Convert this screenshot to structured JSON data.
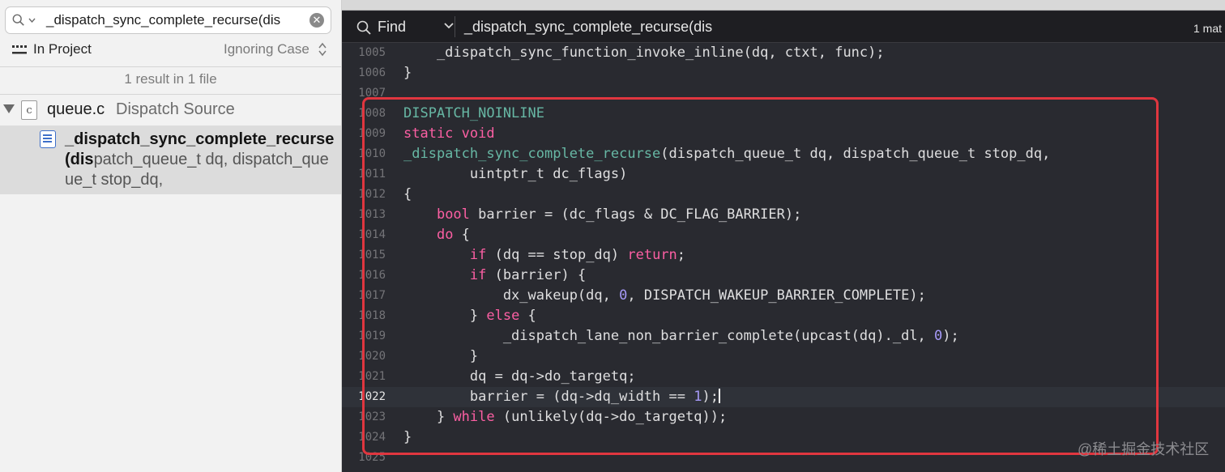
{
  "navigator": {
    "search_query": "_dispatch_sync_complete_recurse(dis",
    "scope_label": "In Project",
    "case_option": "Ignoring Case",
    "summary": "1 result in 1 file",
    "file": {
      "name": "queue.c",
      "kind": "Dispatch Source"
    },
    "result": {
      "match_bold": "_dispatch_sync_complete_recurse(dis",
      "match_rest": "patch_queue_t dq, dispatch_queue_t stop_dq,"
    }
  },
  "findbar": {
    "mode_label": "Find",
    "query": "_dispatch_sync_complete_recurse(dis",
    "match_count": "1 mat"
  },
  "code_lines": [
    {
      "n": "1005",
      "segments": [
        {
          "t": "    _dispatch_sync_function_invoke_inline(dq, ctxt, func);",
          "c": ""
        }
      ]
    },
    {
      "n": "1006",
      "segments": [
        {
          "t": "}",
          "c": ""
        }
      ]
    },
    {
      "n": "1007",
      "segments": []
    },
    {
      "n": "1008",
      "segments": [
        {
          "t": "DISPATCH_NOINLINE",
          "c": "fn"
        }
      ]
    },
    {
      "n": "1009",
      "segments": [
        {
          "t": "static void",
          "c": "kw"
        }
      ]
    },
    {
      "n": "1010",
      "segments": [
        {
          "t": "_dispatch_sync_complete_recurse",
          "c": "fn"
        },
        {
          "t": "(dispatch_queue_t dq, dispatch_queue_t stop_dq,",
          "c": ""
        }
      ]
    },
    {
      "n": "1011",
      "segments": [
        {
          "t": "        uintptr_t dc_flags)",
          "c": ""
        }
      ]
    },
    {
      "n": "1012",
      "segments": [
        {
          "t": "{",
          "c": ""
        }
      ]
    },
    {
      "n": "1013",
      "segments": [
        {
          "t": "    ",
          "c": ""
        },
        {
          "t": "bool",
          "c": "kw"
        },
        {
          "t": " barrier = (dc_flags & DC_FLAG_BARRIER);",
          "c": ""
        }
      ]
    },
    {
      "n": "1014",
      "segments": [
        {
          "t": "    ",
          "c": ""
        },
        {
          "t": "do",
          "c": "kw"
        },
        {
          "t": " {",
          "c": ""
        }
      ]
    },
    {
      "n": "1015",
      "segments": [
        {
          "t": "        ",
          "c": ""
        },
        {
          "t": "if",
          "c": "kw"
        },
        {
          "t": " (dq == stop_dq) ",
          "c": ""
        },
        {
          "t": "return",
          "c": "kw"
        },
        {
          "t": ";",
          "c": ""
        }
      ]
    },
    {
      "n": "1016",
      "segments": [
        {
          "t": "        ",
          "c": ""
        },
        {
          "t": "if",
          "c": "kw"
        },
        {
          "t": " (barrier) {",
          "c": ""
        }
      ]
    },
    {
      "n": "1017",
      "segments": [
        {
          "t": "            dx_wakeup(dq, ",
          "c": ""
        },
        {
          "t": "0",
          "c": "num"
        },
        {
          "t": ", DISPATCH_WAKEUP_BARRIER_COMPLETE);",
          "c": ""
        }
      ]
    },
    {
      "n": "1018",
      "segments": [
        {
          "t": "        } ",
          "c": ""
        },
        {
          "t": "else",
          "c": "kw"
        },
        {
          "t": " {",
          "c": ""
        }
      ]
    },
    {
      "n": "1019",
      "segments": [
        {
          "t": "            _dispatch_lane_non_barrier_complete(upcast(dq)._dl, ",
          "c": ""
        },
        {
          "t": "0",
          "c": "num"
        },
        {
          "t": ");",
          "c": ""
        }
      ]
    },
    {
      "n": "1020",
      "segments": [
        {
          "t": "        }",
          "c": ""
        }
      ]
    },
    {
      "n": "1021",
      "segments": [
        {
          "t": "        dq = dq->do_targetq;",
          "c": ""
        }
      ]
    },
    {
      "n": "1022",
      "current": true,
      "segments": [
        {
          "t": "        barrier = (dq->dq_width == ",
          "c": ""
        },
        {
          "t": "1",
          "c": "num"
        },
        {
          "t": ");",
          "c": ""
        }
      ]
    },
    {
      "n": "1023",
      "segments": [
        {
          "t": "    } ",
          "c": ""
        },
        {
          "t": "while",
          "c": "kw"
        },
        {
          "t": " (unlikely(dq->do_targetq));",
          "c": ""
        }
      ]
    },
    {
      "n": "1024",
      "segments": [
        {
          "t": "}",
          "c": ""
        }
      ]
    },
    {
      "n": "1025",
      "segments": []
    }
  ],
  "watermark": "@稀土掘金技术社区",
  "colors": {
    "editor_bg": "#292a30",
    "keyword": "#fc5fa3",
    "function": "#67b7a4",
    "number": "#a69af8",
    "highlight_box": "#e0363f"
  }
}
